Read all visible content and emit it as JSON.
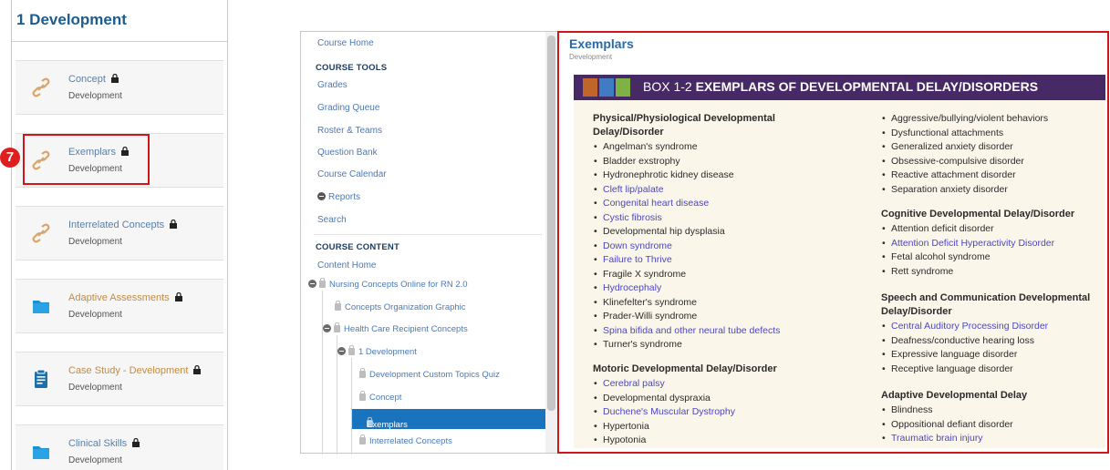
{
  "left": {
    "title": "1 Development",
    "cards": [
      {
        "title": "Concept",
        "sub": "Development",
        "icon": "link-icon",
        "color": "blue"
      },
      {
        "title": "Exemplars",
        "sub": "Development",
        "icon": "link-icon",
        "color": "blue"
      },
      {
        "title": "Interrelated Concepts",
        "sub": "Development",
        "icon": "link-icon",
        "color": "blue"
      },
      {
        "title": "Adaptive Assessments",
        "sub": "Development",
        "icon": "folder-icon",
        "color": "orange"
      },
      {
        "title": "Case Study - Development",
        "sub": "Development",
        "icon": "clipboard-icon",
        "color": "orange"
      },
      {
        "title": "Clinical Skills",
        "sub": "Development",
        "icon": "folder-icon",
        "color": "blue"
      }
    ],
    "step_number": "7"
  },
  "nav": {
    "course_home": "Course Home",
    "tools_header": "COURSE TOOLS",
    "tools": [
      "Grades",
      "Grading Queue",
      "Roster & Teams",
      "Question Bank",
      "Course Calendar",
      "Reports",
      "Search"
    ],
    "content_header": "COURSE CONTENT",
    "content_home": "Content Home",
    "tree": [
      "Nursing Concepts Online for RN 2.0",
      "Concepts Organization Graphic",
      "Health Care Recipient Concepts",
      "1 Development",
      "Development Custom Topics Quiz",
      "Concept",
      "Exemplars",
      "Interrelated Concepts"
    ]
  },
  "content": {
    "title": "Exemplars",
    "subtitle": "Development",
    "box_prefix": "BOX 1-2 ",
    "box_title": "EXEMPLARS OF DEVELOPMENTAL DELAY/DISORDERS",
    "colors": {
      "header_bg": "#472965",
      "sq1": "#c0662a",
      "sq2": "#3f7cc4",
      "sq3": "#7fb244",
      "box_bg": "#fbf6ea",
      "link": "#4a47c2",
      "highlight": "#d0161b"
    },
    "col1": {
      "physical_head": [
        "Physical/Physiological Developmental",
        "Delay/Disorder"
      ],
      "physical": [
        "Angelman's syndrome",
        "Bladder exstrophy",
        "Hydronephrotic kidney disease",
        "Cleft lip/palate",
        "Congenital heart disease",
        "Cystic fibrosis",
        "Developmental hip dysplasia",
        "Down syndrome",
        "Failure to Thrive",
        "Fragile X syndrome",
        "Hydrocephaly",
        "Klinefelter's syndrome",
        "Prader-Willi syndrome",
        "Spina bifida and other neural tube defects",
        "Turner's syndrome"
      ],
      "physical_links": [
        3,
        4,
        5,
        7,
        8,
        10,
        13
      ],
      "motoric_head": "Motoric Developmental Delay/Disorder",
      "motoric": [
        "Cerebral palsy",
        "Developmental dyspraxia",
        "Duchene's Muscular Dystrophy",
        "Hypertonia",
        "Hypotonia"
      ],
      "motoric_links": [
        0,
        2
      ]
    },
    "col2": {
      "behav": [
        "Aggressive/bullying/violent behaviors",
        "Dysfunctional attachments",
        "Generalized anxiety disorder",
        "Obsessive-compulsive disorder",
        "Reactive attachment disorder",
        "Separation anxiety disorder"
      ],
      "cognitive_head": "Cognitive Developmental Delay/Disorder",
      "cognitive": [
        "Attention deficit disorder",
        "Attention Deficit Hyperactivity Disorder",
        "Fetal alcohol syndrome",
        "Rett syndrome"
      ],
      "cognitive_links": [
        1
      ],
      "speech_head": [
        "Speech and Communication Developmental",
        "Delay/Disorder"
      ],
      "speech": [
        "Central Auditory Processing Disorder",
        "Deafness/conductive hearing loss",
        "Expressive language disorder",
        "Receptive language disorder"
      ],
      "speech_links": [
        0
      ],
      "adaptive_head": "Adaptive Developmental Delay",
      "adaptive": [
        "Blindness",
        "Oppositional defiant disorder",
        "Traumatic brain injury"
      ],
      "adaptive_links": [
        2
      ]
    }
  }
}
